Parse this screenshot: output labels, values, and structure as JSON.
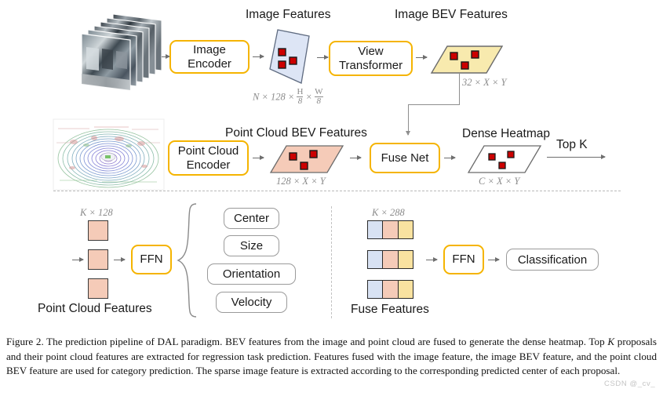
{
  "figure": {
    "stage1": {
      "image_stack_label": "multi-view-camera-images",
      "image_encoder": "Image Encoder",
      "image_features_heading": "Image Features",
      "image_features_dim_prefix": "N × 128 ×",
      "image_features_dim_frac1_num": "H",
      "image_features_dim_frac1_den": "8",
      "image_features_dim_mid": "×",
      "image_features_dim_frac2_num": "W",
      "image_features_dim_frac2_den": "8",
      "view_transformer": "View Transformer",
      "view_transformer_line1": "View",
      "view_transformer_line2": "Transformer",
      "image_bev_heading": "Image BEV Features",
      "image_bev_dim": "32 × X × Y"
    },
    "stage2": {
      "point_cloud_label": "lidar-point-cloud-bev",
      "point_cloud_encoder_line1": "Point Cloud",
      "point_cloud_encoder_line2": "Encoder",
      "pc_bev_heading": "Point Cloud BEV Features",
      "pc_bev_dim": "128 × X × Y",
      "fuse_net": "Fuse Net",
      "dense_heatmap_heading": "Dense Heatmap",
      "dense_heatmap_dim": "C × X × Y",
      "topk_label": "Top K"
    },
    "stage3_regression": {
      "tokens_dim": "K × 128",
      "ffn": "FFN",
      "features_label": "Point Cloud Features",
      "heads": [
        "Center",
        "Size",
        "Orientation",
        "Velocity"
      ]
    },
    "stage3_classification": {
      "tokens_dim": "K × 288",
      "ffn": "FFN",
      "features_label": "Fuse Features",
      "output": "Classification"
    },
    "colors": {
      "module_border": "#f5b400",
      "image_feature_fill": "#dde5f5",
      "image_bev_fill": "#f8eaae",
      "pc_bev_fill": "#f5cbb8",
      "heatmap_fill": "#ffffff",
      "proposal_marker": "#cc0000",
      "token_blue": "#d8e2f3",
      "token_salmon": "#f5cbb8",
      "token_yellow": "#f9e2a0",
      "arrow_gray": "#6e6e6e"
    }
  },
  "caption": {
    "prefix": "Figure 2.",
    "text_part1": " The prediction pipeline of DAL paradigm. BEV features from the image and point cloud are fused to generate the dense heatmap. Top ",
    "italic_k": "K",
    "text_part2": " proposals and their point cloud features are extracted for regression task prediction. Features fused with the image feature, the image BEV feature, and the point cloud BEV feature are used for category prediction.  The sparse image feature is extracted according to the corresponding predicted center of each proposal.",
    "watermark": "CSDN @_cv_"
  }
}
